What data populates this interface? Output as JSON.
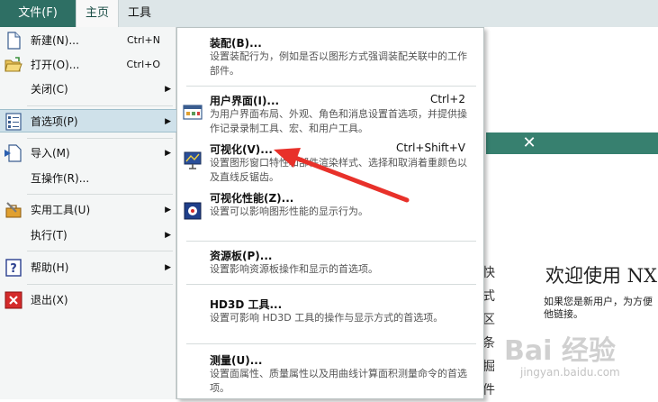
{
  "menubar": {
    "tabs": [
      {
        "label": "文件(F)"
      },
      {
        "label": "主页"
      },
      {
        "label": "工具"
      }
    ]
  },
  "file_menu": {
    "items": [
      {
        "label": "新建(N)...",
        "shortcut": "Ctrl+N",
        "icon": "new-document-icon"
      },
      {
        "label": "打开(O)...",
        "shortcut": "Ctrl+O",
        "icon": "open-folder-icon"
      },
      {
        "label": "关闭(C)",
        "icon": ""
      },
      {
        "label": "首选项(P)",
        "icon": "preferences-icon"
      },
      {
        "label": "导入(M)",
        "icon": "import-icon"
      },
      {
        "label": "互操作(R)...",
        "icon": ""
      },
      {
        "label": "实用工具(U)",
        "icon": "utilities-icon"
      },
      {
        "label": "执行(T)",
        "icon": ""
      },
      {
        "label": "帮助(H)",
        "icon": "help-icon"
      },
      {
        "label": "退出(X)",
        "icon": "exit-icon"
      }
    ]
  },
  "preferences_submenu": {
    "items": [
      {
        "title": "装配(B)...",
        "desc": "设置装配行为，例如是否以图形方式强调装配关联中的工作部件。"
      },
      {
        "title": "用户界面(I)...",
        "shortcut": "Ctrl+2",
        "desc": "为用户界面布局、外观、角色和消息设置首选项，并提供操作记录录制工具、宏、和用户工具。"
      },
      {
        "title": "可视化(V)...",
        "shortcut": "Ctrl+Shift+V",
        "desc": "设置图形窗口特性和部件渲染样式、选择和取消着重颜色以及直线反锯齿。"
      },
      {
        "title": "可视化性能(Z)...",
        "desc": "设置可以影响图形性能的显示行为。"
      },
      {
        "title": "资源板(P)...",
        "desc": "设置影响资源板操作和显示的首选项。"
      },
      {
        "title": "HD3D 工具...",
        "desc": "设置可影响 HD3D 工具的操作与显示方式的首选项。"
      },
      {
        "title": "测量(U)...",
        "desc": "设置面属性、质量属性以及用曲线计算面积测量命令的首选项。"
      }
    ]
  },
  "background": {
    "close_glyph": "✕",
    "vertical_chars": [
      "快",
      "式",
      "区",
      "条",
      "掘",
      "件"
    ],
    "welcome_title": "欢迎使用 NX",
    "intro_text": "如果您是新用户，为方便他链接。"
  },
  "watermark": {
    "text": "Bai 经验",
    "url": "jingyan.baidu.com"
  },
  "colors": {
    "file_tab": "#2e6f64",
    "accent_bar": "#37806f",
    "selection": "#cfe1ea",
    "arrow": "#e8312a"
  }
}
